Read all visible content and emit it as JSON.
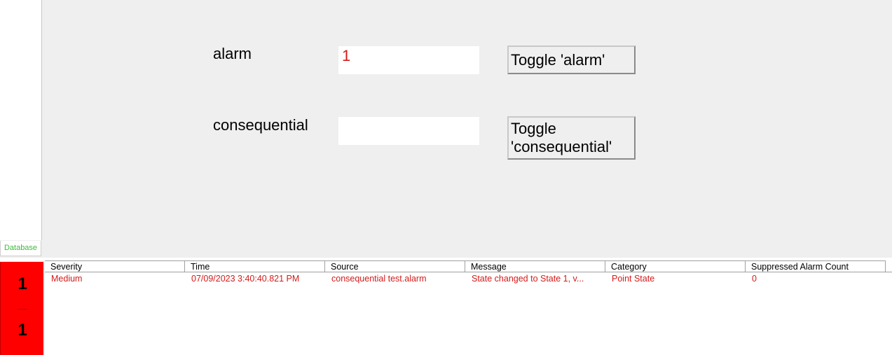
{
  "sidebar": {
    "tab_label": "Database"
  },
  "panel": {
    "rows": [
      {
        "label": "alarm",
        "value": "1",
        "button": "Toggle 'alarm'"
      },
      {
        "label": "consequential",
        "value": "",
        "button": "Toggle 'consequential'"
      }
    ]
  },
  "alarm_counter": {
    "top": "1",
    "bottom": "1",
    "color": "#ff0000"
  },
  "alarm_table": {
    "columns": [
      "Severity",
      "Time",
      "Source",
      "Message",
      "Category",
      "Suppressed Alarm Count"
    ],
    "rows": [
      {
        "severity": "Medium",
        "time": "07/09/2023 3:40:40.821 PM",
        "source": "consequential test.alarm",
        "message": "State changed to State 1, v...",
        "category": "Point State",
        "suppressed_count": "0"
      }
    ]
  },
  "colors": {
    "alarm_text": "#d41a1a",
    "database_tab_text": "#3cbc3c"
  }
}
